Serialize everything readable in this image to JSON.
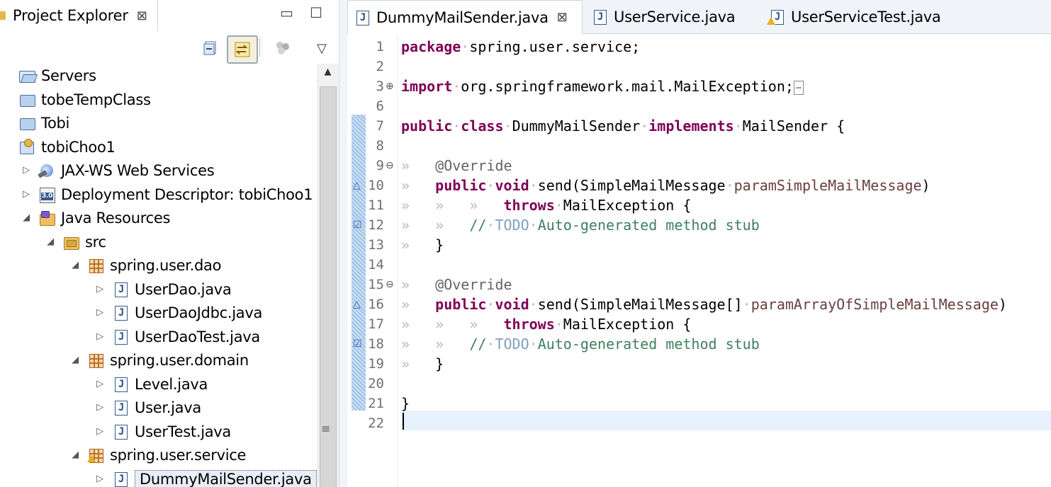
{
  "project_explorer": {
    "title": "Project Explorer",
    "close_icon": "⊠",
    "minimize_glyph": "▭",
    "maximize_glyph": "☐",
    "view_menu_glyph": "▽",
    "tree": [
      {
        "label": "Servers",
        "icon": "folder-open-icon",
        "twisty": ""
      },
      {
        "label": "tobeTempClass",
        "icon": "folder-icon",
        "twisty": ""
      },
      {
        "label": "Tobi",
        "icon": "folder-icon",
        "twisty": ""
      },
      {
        "label": "tobiChoo1",
        "icon": "project-icon",
        "twisty": ""
      },
      {
        "label": "JAX-WS Web Services",
        "icon": "web-services-icon",
        "twisty": "▷"
      },
      {
        "label": "Deployment Descriptor: tobiChoo1",
        "icon": "deployment-descriptor-icon",
        "twisty": "▷"
      },
      {
        "label": "Java Resources",
        "icon": "java-resources-icon",
        "twisty": "◢"
      },
      {
        "label": "src",
        "icon": "source-folder-icon",
        "twisty": "◢"
      },
      {
        "label": "spring.user.dao",
        "icon": "package-icon",
        "twisty": "◢"
      },
      {
        "label": "UserDao.java",
        "icon": "java-file-icon",
        "twisty": "▷"
      },
      {
        "label": "UserDaoJdbc.java",
        "icon": "java-file-icon",
        "twisty": "▷"
      },
      {
        "label": "UserDaoTest.java",
        "icon": "java-file-icon",
        "twisty": "▷"
      },
      {
        "label": "spring.user.domain",
        "icon": "package-icon",
        "twisty": "◢"
      },
      {
        "label": "Level.java",
        "icon": "java-file-icon",
        "twisty": "▷"
      },
      {
        "label": "User.java",
        "icon": "java-file-icon",
        "twisty": "▷"
      },
      {
        "label": "UserTest.java",
        "icon": "java-file-icon",
        "twisty": "▷"
      },
      {
        "label": "spring.user.service",
        "icon": "package-warning-icon",
        "twisty": "◢"
      },
      {
        "label": "DummyMailSender.java",
        "icon": "java-file-icon",
        "twisty": "▷"
      }
    ],
    "scroll_up_glyph": "▲",
    "scroll_grip_glyph": "≡"
  },
  "editor": {
    "tabs": [
      {
        "label": "DummyMailSender.java",
        "close": "⊠",
        "icon": "java-file-icon"
      },
      {
        "label": "UserService.java",
        "icon": "java-file-icon"
      },
      {
        "label": "UserServiceTest.java",
        "icon": "java-file-warning-icon"
      }
    ],
    "line_numbers": [
      "1",
      "2",
      "3",
      "6",
      "7",
      "8",
      "9",
      "10",
      "11",
      "12",
      "13",
      "14",
      "15",
      "16",
      "17",
      "18",
      "19",
      "20",
      "21",
      "22"
    ],
    "fold_glyphs": {
      "plus": "⊕",
      "minus": "⊖",
      "ws": "»"
    },
    "code": {
      "l1_kw": "package",
      "l1_rest": "spring.user.service;",
      "l3_kw": "import",
      "l3_rest": "org.springframework.mail.MailException;",
      "l7_kw1": "public",
      "l7_kw2": "class",
      "l7_name": "DummyMailSender",
      "l7_kw3": "implements",
      "l7_rest": "MailSender {",
      "l9_ann": "@Override",
      "l10_kw1": "public",
      "l10_kw2": "void",
      "l10_sig": "send(SimpleMailMessage",
      "l10_param": "paramSimpleMailMessage",
      "l10_end": ")",
      "l11_kw": "throws",
      "l11_rest": "MailException {",
      "l12_cm": "//",
      "l12_todo": "TODO",
      "l12_rest": "Auto-generated method stub",
      "l13": "}",
      "l15_ann": "@Override",
      "l16_kw1": "public",
      "l16_kw2": "void",
      "l16_sig": "send(SimpleMailMessage[]",
      "l16_param": "paramArrayOfSimpleMailMessage",
      "l16_end": ")",
      "l17_kw": "throws",
      "l17_rest": "MailException {",
      "l18_cm": "//",
      "l18_todo": "TODO",
      "l18_rest": "Auto-generated method stub",
      "l19": "}",
      "l21": "}"
    }
  }
}
